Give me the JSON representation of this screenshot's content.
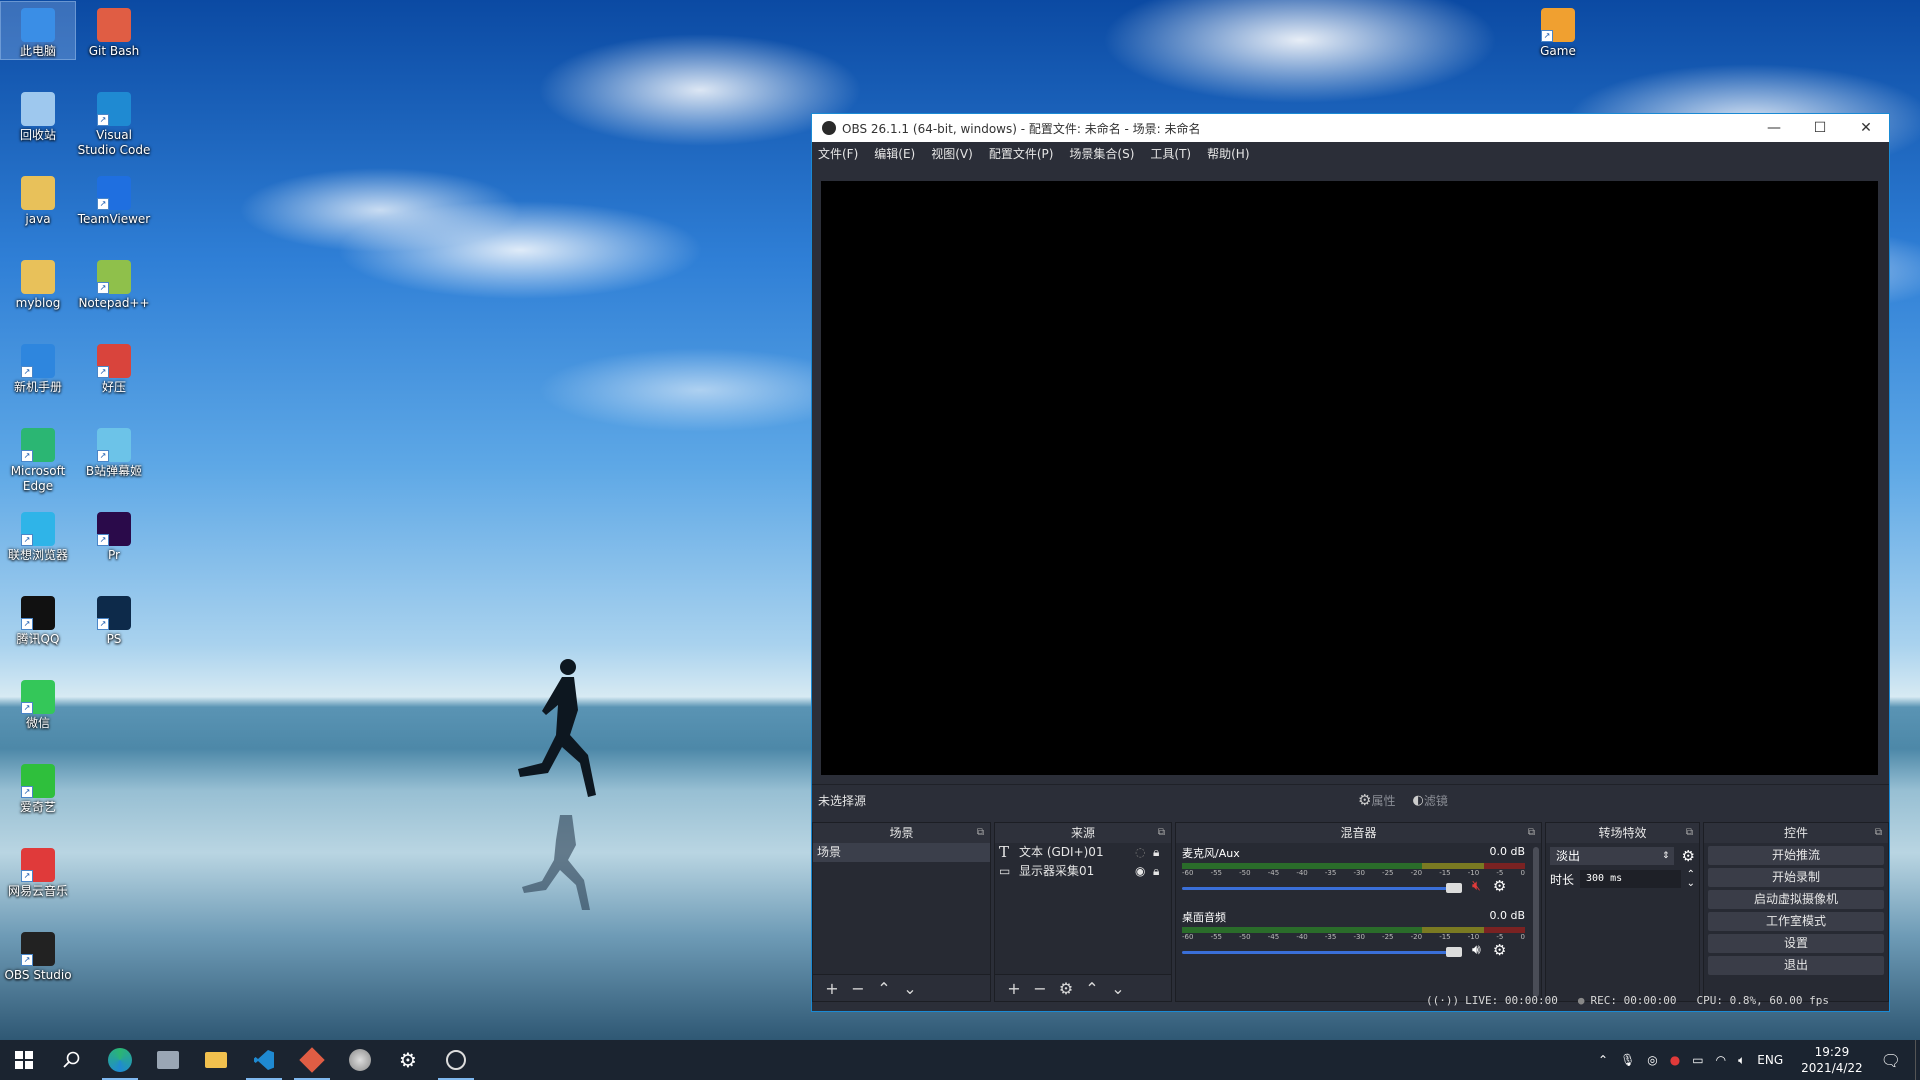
{
  "desktop": {
    "icons": [
      {
        "label": "此电脑",
        "icon": "computer-icon",
        "color": "#3a8ee6"
      },
      {
        "label": "Git Bash",
        "icon": "git-icon",
        "color": "#e05d44"
      },
      {
        "label": "回收站",
        "icon": "recycle-bin-icon",
        "color": "#9ec8ee"
      },
      {
        "label": "Visual Studio Code",
        "icon": "vscode-icon",
        "color": "#1f8ad2"
      },
      {
        "label": "java",
        "icon": "folder-icon",
        "color": "#e8c15a"
      },
      {
        "label": "TeamViewer",
        "icon": "teamviewer-icon",
        "color": "#1f6fe0"
      },
      {
        "label": "myblog",
        "icon": "folder-icon",
        "color": "#e8c15a"
      },
      {
        "label": "Notepad++",
        "icon": "notepadpp-icon",
        "color": "#8fc04b"
      },
      {
        "label": "新机手册",
        "icon": "manual-icon",
        "color": "#2e86de"
      },
      {
        "label": "好压",
        "icon": "haozip-icon",
        "color": "#d9443c"
      },
      {
        "label": "Microsoft Edge",
        "icon": "edge-icon",
        "color": "#2bb673"
      },
      {
        "label": "B站弹幕姬",
        "icon": "bilibili-icon",
        "color": "#6cc3e8"
      },
      {
        "label": "联想浏览器",
        "icon": "lenovo-browser-icon",
        "color": "#2fb4e8"
      },
      {
        "label": "Pr",
        "icon": "premiere-icon",
        "color": "#2a0a4a"
      },
      {
        "label": "腾讯QQ",
        "icon": "qq-icon",
        "color": "#111111"
      },
      {
        "label": "PS",
        "icon": "photoshop-icon",
        "color": "#0d2a4a"
      },
      {
        "label": "微信",
        "icon": "wechat-icon",
        "color": "#34c759"
      },
      {
        "label": "爱奇艺",
        "icon": "iqiyi-icon",
        "color": "#2fbf3c"
      },
      {
        "label": "网易云音乐",
        "icon": "netease-music-icon",
        "color": "#e03a3a"
      },
      {
        "label": "OBS Studio",
        "icon": "obs-icon",
        "color": "#222222"
      },
      {
        "label": "Game",
        "icon": "game-icon",
        "color": "#f0a030"
      }
    ]
  },
  "obs": {
    "title": "OBS 26.1.1 (64-bit, windows) - 配置文件: 未命名 - 场景: 未命名",
    "menu": [
      "文件(F)",
      "编辑(E)",
      "视图(V)",
      "配置文件(P)",
      "场景集合(S)",
      "工具(T)",
      "帮助(H)"
    ],
    "source_bar": {
      "no_selection": "未选择源",
      "properties": "属性",
      "filters": "滤镜"
    },
    "docks": {
      "scenes": {
        "title": "场景",
        "items": [
          "场景"
        ]
      },
      "sources": {
        "title": "来源",
        "items": [
          "文本 (GDI+)01",
          "显示器采集01"
        ]
      },
      "mixer": {
        "title": "混音器",
        "channels": [
          {
            "name": "麦克风/Aux",
            "db": "0.0 dB",
            "muted": true,
            "level": 0.95
          },
          {
            "name": "桌面音频",
            "db": "0.0 dB",
            "muted": false,
            "level": 0.95
          }
        ],
        "scale": [
          "-60",
          "-55",
          "-50",
          "-45",
          "-40",
          "-35",
          "-30",
          "-25",
          "-20",
          "-15",
          "-10",
          "-5",
          "0"
        ]
      },
      "transitions": {
        "title": "转场特效",
        "selected": "淡出",
        "duration_label": "时长",
        "duration_value": "300 ms"
      },
      "controls": {
        "title": "控件",
        "buttons": [
          "开始推流",
          "开始录制",
          "启动虚拟摄像机",
          "工作室模式",
          "设置",
          "退出"
        ]
      }
    },
    "status": {
      "live": "LIVE: 00:00:00",
      "rec": "REC: 00:00:00",
      "cpu": "CPU: 0.8%, 60.00 fps"
    }
  },
  "taskbar": {
    "apps": [
      "windows-start-icon",
      "search-icon",
      "edge-icon",
      "file-manager-icon",
      "folder-icon",
      "vscode-icon",
      "git-icon",
      "browser-icon",
      "settings-icon",
      "obs-icon"
    ],
    "lang": "ENG",
    "time": "19:29",
    "date": "2021/4/22"
  }
}
